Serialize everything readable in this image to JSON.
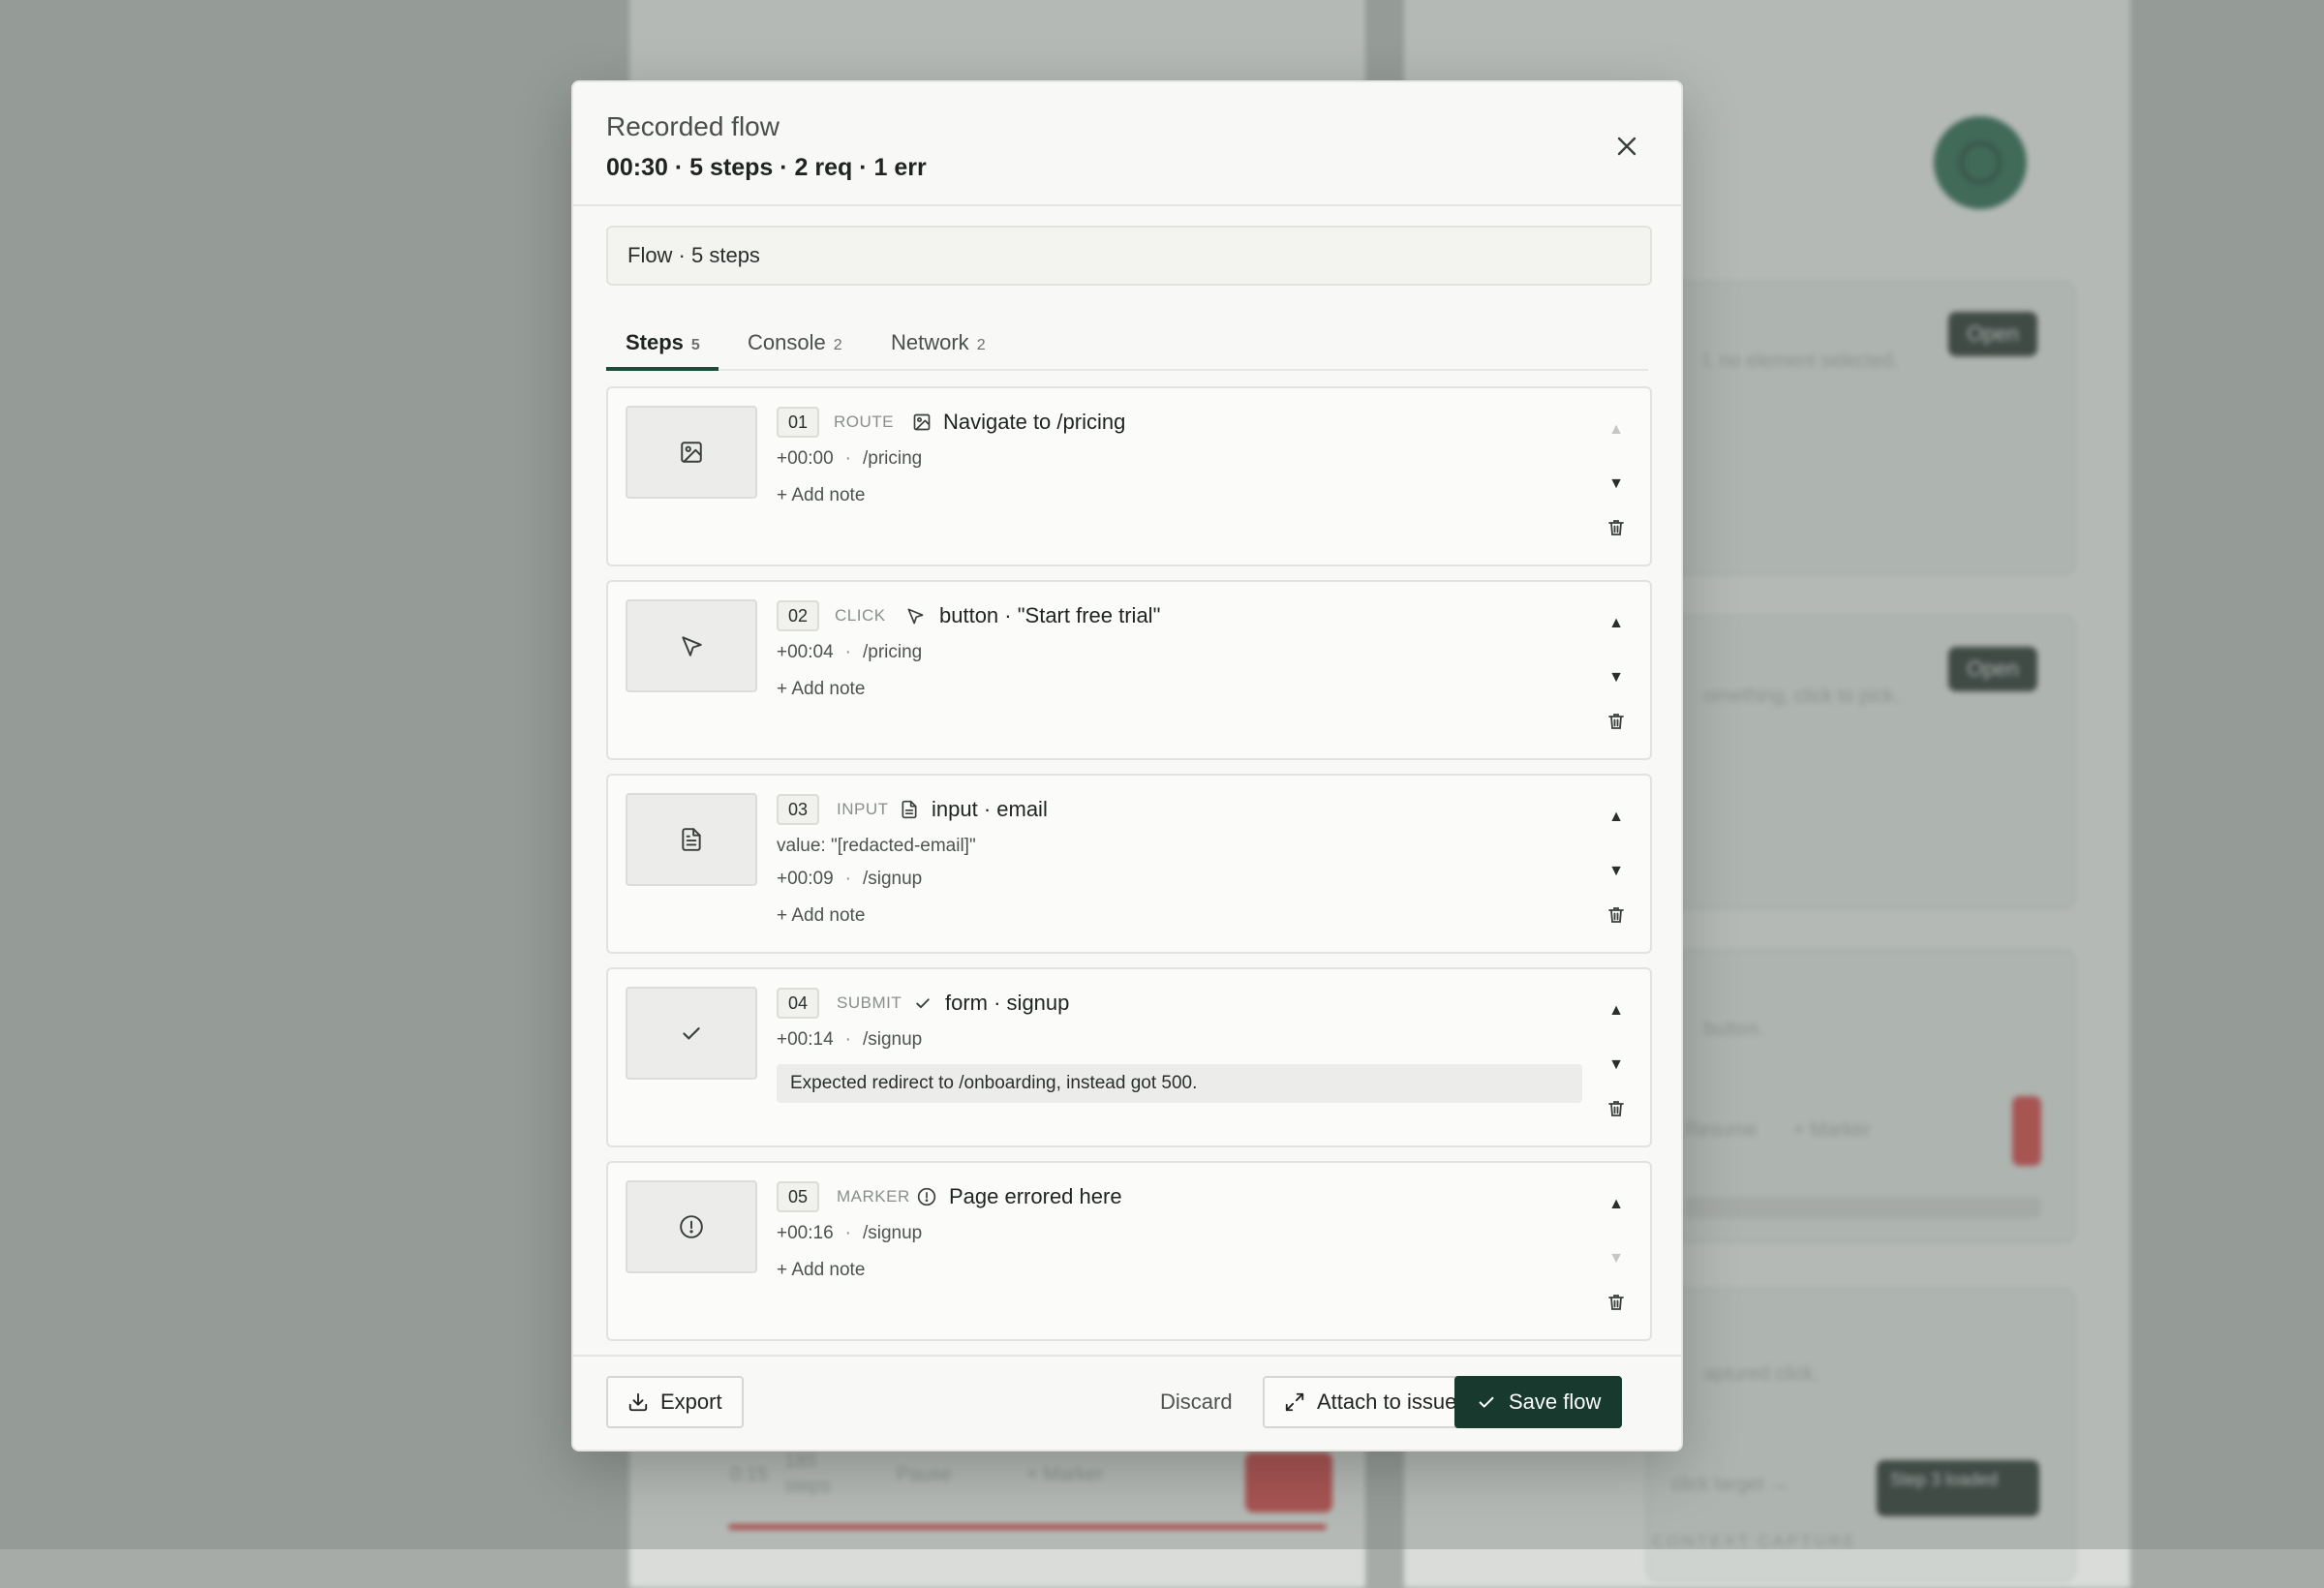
{
  "modal": {
    "title": "Recorded flow",
    "summary": "00:30 · 5 steps · 2 req · 1 err",
    "flow_name_value": "Flow · 5 steps",
    "tabs": [
      {
        "label": "Steps",
        "count": "5"
      },
      {
        "label": "Console",
        "count": "2"
      },
      {
        "label": "Network",
        "count": "2"
      }
    ],
    "steps": [
      {
        "num": "01",
        "kind": "ROUTE",
        "icon": "image-icon",
        "label": "Navigate to /pricing",
        "time": "+00:00",
        "path": "/pricing",
        "note": "+ Add note"
      },
      {
        "num": "02",
        "kind": "CLICK",
        "icon": "cursor-icon",
        "label": "button · \"Start free trial\"",
        "time": "+00:04",
        "path": "/pricing",
        "note": "+ Add note"
      },
      {
        "num": "03",
        "kind": "INPUT",
        "icon": "document-icon",
        "label": "input · email",
        "value": "value: \"[redacted-email]\"",
        "time": "+00:09",
        "path": "/signup",
        "note": "+ Add note"
      },
      {
        "num": "04",
        "kind": "SUBMIT",
        "icon": "check-icon",
        "label": "form · signup",
        "time": "+00:14",
        "path": "/signup",
        "comment": "Expected redirect to /onboarding, instead got 500."
      },
      {
        "num": "05",
        "kind": "MARKER",
        "icon": "alert-circle-icon",
        "label": "Page errored here",
        "time": "+00:16",
        "path": "/signup",
        "note": "+ Add note"
      }
    ],
    "footer": {
      "export": "Export",
      "discard": "Discard",
      "attach": "Attach to issue",
      "save": "Save flow"
    }
  },
  "background": {
    "open_label": "Open",
    "status_text": "l, no element selected.",
    "pick_hint": "omething, click to pick.",
    "resume_label": "Resume",
    "marker_label": "+ Marker",
    "pause_label": "Pause",
    "time_readout": "0:15",
    "steps_readout": "185 steps",
    "button_hint": "button.",
    "captured_click": "aptured click.",
    "click_target": "click target →",
    "step_loaded": "Step 3 loaded",
    "context_capture": "CONTEXT CAPTURE"
  },
  "colors": {
    "primary": "#17392e",
    "fab": "#1f5c45",
    "danger": "#c43a3a"
  }
}
